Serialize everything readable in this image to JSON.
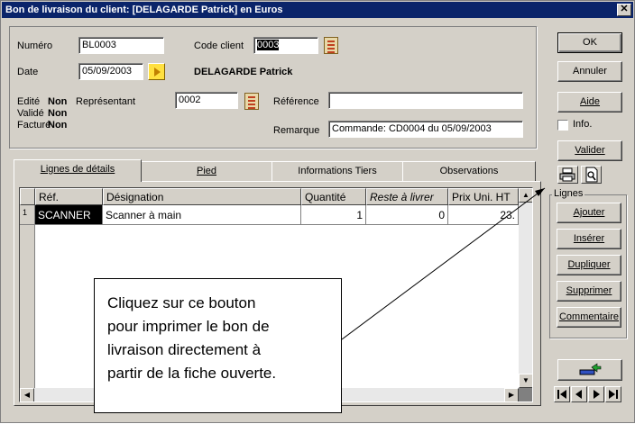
{
  "window": {
    "title": "Bon de livraison du client: [DELAGARDE Patrick] en Euros",
    "close_glyph": "✕"
  },
  "header": {
    "numero_label": "Numéro",
    "numero_value": "BL0003",
    "code_client_label": "Code client",
    "code_client_value": "0003",
    "date_label": "Date",
    "date_value": "05/09/2003",
    "client_name": "DELAGARDE Patrick",
    "edite_label": "Edité",
    "edite_value": "Non",
    "valide_label": "Validé",
    "valide_value": "Non",
    "facture_label": "Facturé",
    "facture_value": "Non",
    "representant_label": "Représentant",
    "representant_value": "0002",
    "reference_label": "Référence",
    "reference_value": "",
    "remarque_label": "Remarque",
    "remarque_value": "Commande: CD0004 du 05/09/2003"
  },
  "right_buttons": {
    "ok": "OK",
    "annuler": "Annuler",
    "aide": "Aide",
    "info": "Info.",
    "valider": "Valider"
  },
  "tabs": [
    {
      "label": "Lignes de détails"
    },
    {
      "label": "Pied"
    },
    {
      "label": "Informations Tiers"
    },
    {
      "label": "Observations"
    }
  ],
  "grid": {
    "columns": [
      "Réf.",
      "Désignation",
      "Quantité",
      "Reste à livrer",
      "Prix Uni. HT"
    ],
    "rows": [
      {
        "num": "1",
        "ref": "SCANNER",
        "designation": "Scanner à main",
        "quantite": "1",
        "reste": "0",
        "prix": "23."
      }
    ]
  },
  "lignes_group": {
    "title": "Lignes",
    "buttons": [
      "Ajouter",
      "Insérer",
      "Dupliquer",
      "Supprimer",
      "Commentaire"
    ]
  },
  "callout": {
    "lines": [
      "Cliquez sur ce bouton",
      "pour imprimer le bon de",
      "livraison directement à",
      "partir de la fiche ouverte."
    ]
  },
  "icons": [
    "printer-icon",
    "print-preview-icon",
    "picker-list-icon",
    "next-arrow-icon",
    "export-icon",
    "first-record-icon",
    "previous-record-icon",
    "next-record-icon",
    "last-record-icon"
  ],
  "colors": {
    "titlebar": "#0a246a",
    "face": "#d4d0c8",
    "highlight_arrow": "#ffe040"
  }
}
